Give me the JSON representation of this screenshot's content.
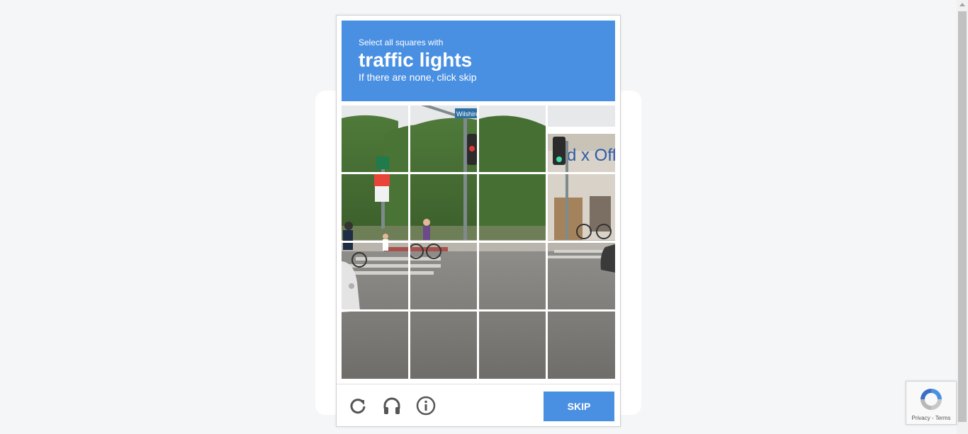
{
  "challenge": {
    "instruction": "Select all squares with",
    "target": "traffic lights",
    "hint": "If there are none, click skip"
  },
  "scene": {
    "street_sign": "Wilshire",
    "store_sign": "d x Off"
  },
  "grid": {
    "rows": 4,
    "cols": 4
  },
  "footer": {
    "reload_icon": "reload-icon",
    "audio_icon": "headphones-icon",
    "info_icon": "info-icon",
    "skip_label": "SKIP"
  },
  "badge": {
    "privacy_label": "Privacy",
    "separator": " - ",
    "terms_label": "Terms"
  },
  "colors": {
    "header_bg": "#4a90e2",
    "skip_bg": "#4a90e2",
    "icon_gray": "#555555"
  }
}
